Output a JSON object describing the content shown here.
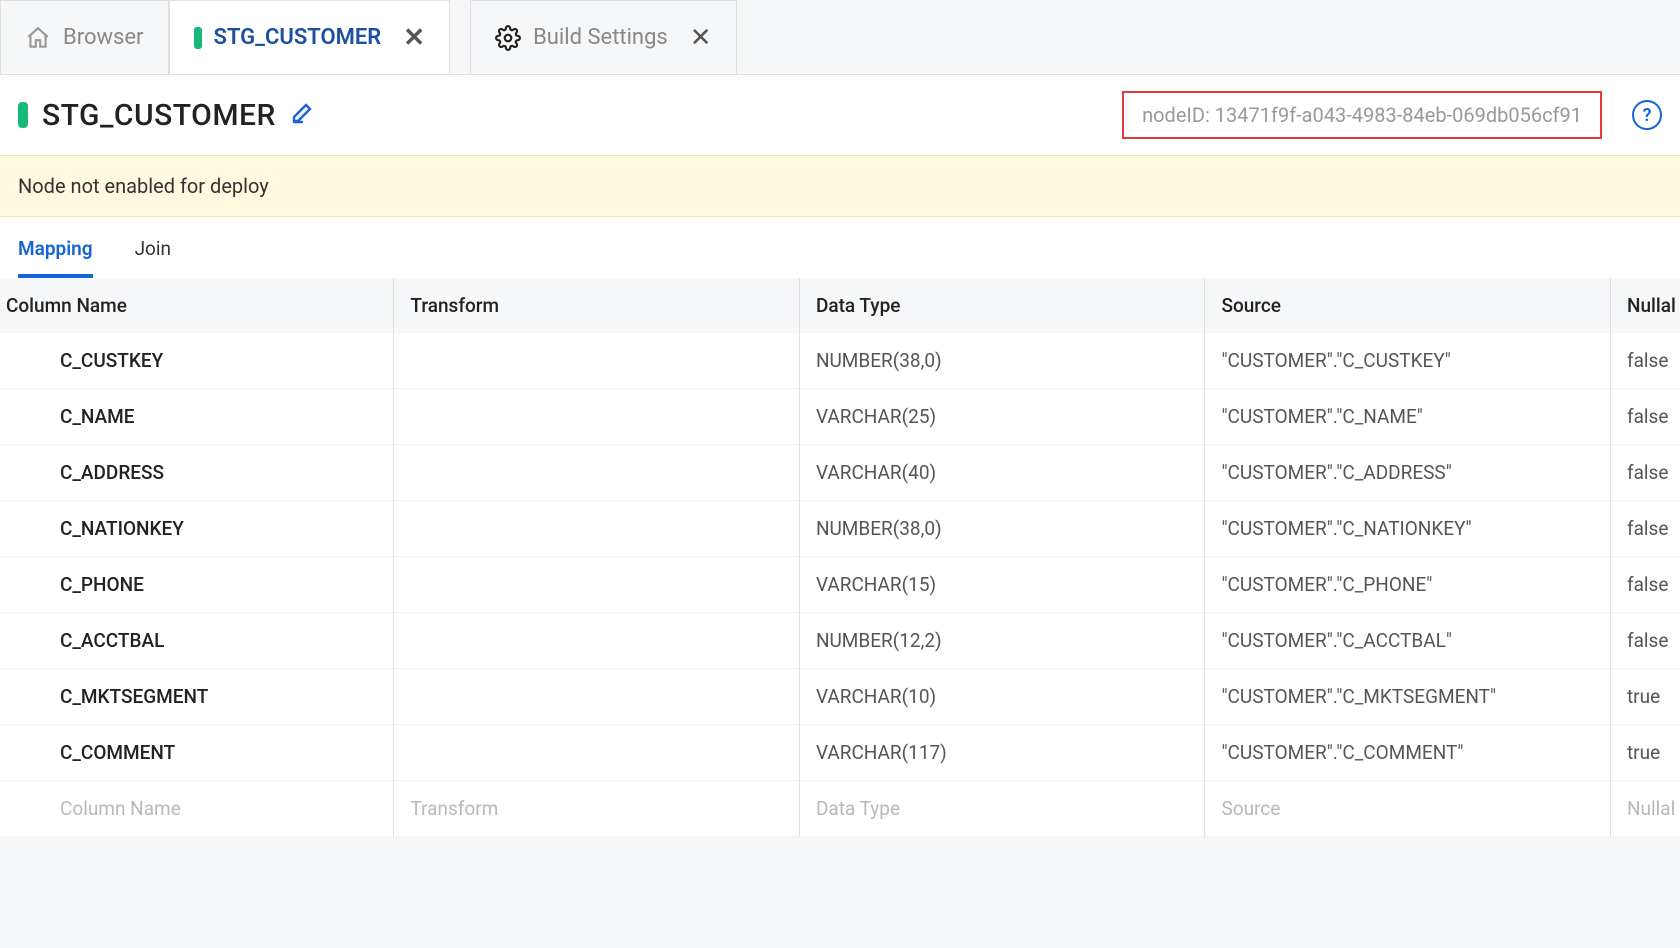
{
  "tabs": {
    "browser": "Browser",
    "active_label": "STG_CUSTOMER",
    "build_settings": "Build Settings"
  },
  "header": {
    "title": "STG_CUSTOMER",
    "node_id": "nodeID: 13471f9f-a043-4983-84eb-069db056cf91"
  },
  "banner": {
    "text": "Node not enabled for deploy"
  },
  "subtabs": {
    "mapping": "Mapping",
    "join": "Join"
  },
  "columns": {
    "name": "Column Name",
    "transform": "Transform",
    "datatype": "Data Type",
    "source": "Source",
    "nullable": "Nullal"
  },
  "placeholder": {
    "name": "Column Name",
    "transform": "Transform",
    "datatype": "Data Type",
    "source": "Source",
    "nullable": "Nullal"
  },
  "rows": [
    {
      "name": "C_CUSTKEY",
      "transform": "",
      "datatype": "NUMBER(38,0)",
      "source": "\"CUSTOMER\".\"C_CUSTKEY\"",
      "nullable": "false"
    },
    {
      "name": "C_NAME",
      "transform": "",
      "datatype": "VARCHAR(25)",
      "source": "\"CUSTOMER\".\"C_NAME\"",
      "nullable": "false"
    },
    {
      "name": "C_ADDRESS",
      "transform": "",
      "datatype": "VARCHAR(40)",
      "source": "\"CUSTOMER\".\"C_ADDRESS\"",
      "nullable": "false"
    },
    {
      "name": "C_NATIONKEY",
      "transform": "",
      "datatype": "NUMBER(38,0)",
      "source": "\"CUSTOMER\".\"C_NATIONKEY\"",
      "nullable": "false"
    },
    {
      "name": "C_PHONE",
      "transform": "",
      "datatype": "VARCHAR(15)",
      "source": "\"CUSTOMER\".\"C_PHONE\"",
      "nullable": "false"
    },
    {
      "name": "C_ACCTBAL",
      "transform": "",
      "datatype": "NUMBER(12,2)",
      "source": "\"CUSTOMER\".\"C_ACCTBAL\"",
      "nullable": "false"
    },
    {
      "name": "C_MKTSEGMENT",
      "transform": "",
      "datatype": "VARCHAR(10)",
      "source": "\"CUSTOMER\".\"C_MKTSEGMENT\"",
      "nullable": "true"
    },
    {
      "name": "C_COMMENT",
      "transform": "",
      "datatype": "VARCHAR(117)",
      "source": "\"CUSTOMER\".\"C_COMMENT\"",
      "nullable": "true"
    }
  ]
}
